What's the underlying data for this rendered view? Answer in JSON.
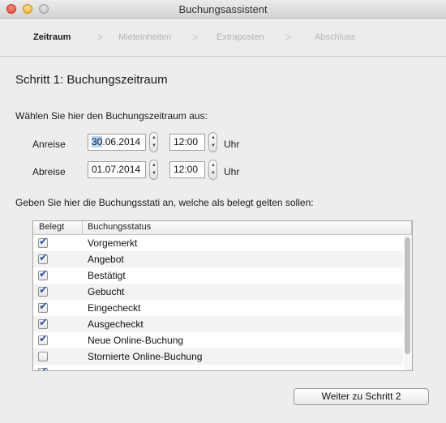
{
  "window": {
    "title": "Buchungsassistent"
  },
  "steps": [
    {
      "label": "Zeitraum",
      "active": true
    },
    {
      "label": "Mieteinheiten",
      "active": false
    },
    {
      "label": "Extraposten",
      "active": false
    },
    {
      "label": "Abschluss",
      "active": false
    }
  ],
  "step_separator": ">",
  "heading": "Schritt 1: Buchungszeitraum",
  "period_prompt": "Wählen Sie hier den Buchungszeitraum aus:",
  "arrival": {
    "label": "Anreise",
    "date_selected": "30",
    "date_rest": ".06.2014",
    "time": "12:00",
    "unit": "Uhr"
  },
  "departure": {
    "label": "Abreise",
    "date": "01.07.2014",
    "time": "12:00",
    "unit": "Uhr"
  },
  "status_prompt": "Geben Sie hier die Buchungsstati an, welche als belegt gelten sollen:",
  "table": {
    "columns": [
      "Belegt",
      "Buchungsstatus"
    ],
    "rows": [
      {
        "checked": true,
        "status": "Vorgemerkt"
      },
      {
        "checked": true,
        "status": "Angebot"
      },
      {
        "checked": true,
        "status": "Bestätigt"
      },
      {
        "checked": true,
        "status": "Gebucht"
      },
      {
        "checked": true,
        "status": "Eingecheckt"
      },
      {
        "checked": true,
        "status": "Ausgecheckt"
      },
      {
        "checked": true,
        "status": "Neue Online-Buchung"
      },
      {
        "checked": false,
        "status": "Stornierte Online-Buchung"
      },
      {
        "checked": true,
        "status": ""
      }
    ]
  },
  "next_button": "Weiter zu Schritt 2",
  "icons": {
    "checkmark": "checkmark-icon",
    "stepper_up": "chevron-up-icon",
    "stepper_down": "chevron-down-icon"
  },
  "colors": {
    "checkmark": "#2c55a8",
    "selection": "#b3d4fc",
    "inactive_step": "#b5b5b5"
  }
}
